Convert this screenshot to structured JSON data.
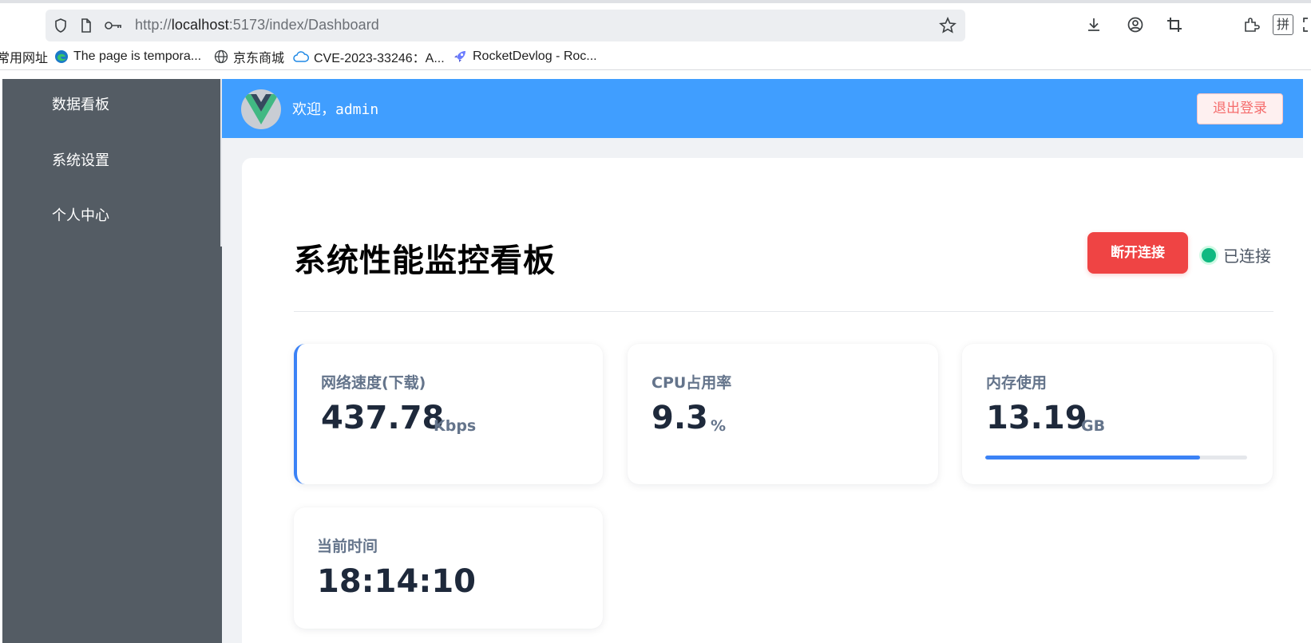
{
  "browser": {
    "url_prefix": "http://",
    "url_host": "localhost",
    "url_rest": ":5173/index/Dashboard",
    "bookmarks": [
      {
        "label": "常用网址",
        "icon": "none"
      },
      {
        "label": "The page is tempora...",
        "icon": "edge-icon"
      },
      {
        "label": "京东商城",
        "icon": "globe-icon"
      },
      {
        "label": "CVE-2023-33246：A...",
        "icon": "cloud-icon"
      },
      {
        "label": "RocketDevlog - Roc...",
        "icon": "rocket-icon"
      }
    ],
    "ime_label": "拼"
  },
  "sidebar": {
    "items": [
      {
        "label": "数据看板"
      },
      {
        "label": "系统设置"
      },
      {
        "label": "个人中心"
      }
    ]
  },
  "header": {
    "welcome": "欢迎，admin",
    "logout_label": "退出登录"
  },
  "dashboard": {
    "title": "系统性能监控看板",
    "disconnect_label": "断开连接",
    "status_label": "已连接",
    "cards": {
      "network": {
        "label": "网络速度(下载)",
        "value": "437.78",
        "unit": "Kbps"
      },
      "cpu": {
        "label": "CPU占用率",
        "value": "9.3",
        "unit": "%"
      },
      "memory": {
        "label": "内存使用",
        "value": "13.19",
        "unit": "GB",
        "usage_fraction": 0.82
      },
      "time": {
        "label": "当前时间",
        "value": "18:14:10"
      }
    }
  },
  "colors": {
    "header": "#409eff",
    "sidebar": "#545c64",
    "accent": "#3b82f6",
    "danger": "#ef4444",
    "connected": "#10b981"
  }
}
